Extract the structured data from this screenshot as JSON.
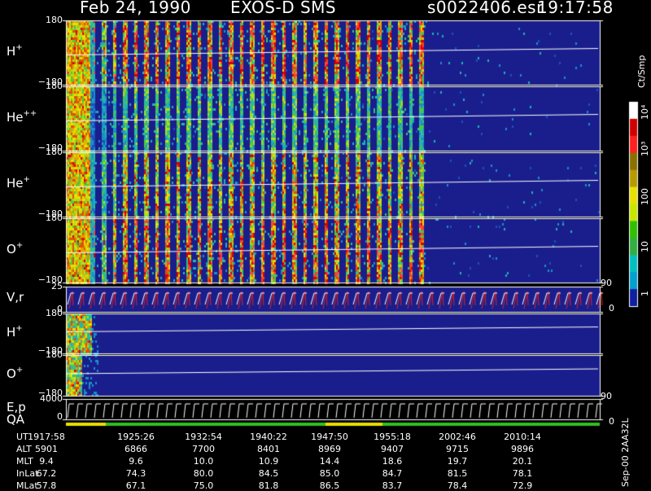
{
  "title": {
    "date": "Feb 24, 1990",
    "instrument": "EXOS-D SMS",
    "file": "s0022406.esr",
    "time": "19:17:58"
  },
  "panels": [
    {
      "label": "H",
      "charge": "+",
      "ymax": "180",
      "ymin": "−180"
    },
    {
      "label": "He",
      "charge": "++",
      "ymax": "180",
      "ymin": "−180"
    },
    {
      "label": "He",
      "charge": "+",
      "ymax": "180",
      "ymin": "−180"
    },
    {
      "label": "O",
      "charge": "+",
      "ymax": "180",
      "ymin": "−180"
    },
    {
      "label": "V,r",
      "charge": "",
      "ymax": "25",
      "ymin": "0"
    },
    {
      "label": "H",
      "charge": "+",
      "ymax": "180",
      "ymin": "−180"
    },
    {
      "label": "O",
      "charge": "+",
      "ymax": "180",
      "ymin": "−180"
    },
    {
      "label": "E,p",
      "charge": "",
      "ymax": "4000",
      "ymin": "0"
    }
  ],
  "qa_label": "QA",
  "right_ticks": {
    "vr_top": "90",
    "vr_bottom": "0",
    "ep_top": "90",
    "ep_bottom": "0"
  },
  "colorbar": {
    "unit": "Ct/Smp",
    "labels": [
      "10⁴",
      "10³",
      "100",
      "10",
      "1"
    ],
    "colors": [
      "#ffffff",
      "#d00000",
      "#ff2020",
      "#8a7000",
      "#b89a00",
      "#e8e000",
      "#c8e800",
      "#30c000",
      "#30b040",
      "#00c0c0",
      "#00a0d0",
      "#1020a0"
    ]
  },
  "footer_note": "Sep-00 2AA32L",
  "chart_data": {
    "type": "heatmap",
    "x": [
      "1917:58",
      "1925:26",
      "1932:54",
      "1940:22",
      "1947:50",
      "1955:18",
      "2002:46",
      "2010:14"
    ],
    "rows": [
      {
        "name": "UT",
        "values": [
          "1917:58",
          "1925:26",
          "1932:54",
          "1940:22",
          "1947:50",
          "1955:18",
          "2002:46",
          "2010:14"
        ]
      },
      {
        "name": "ALT",
        "values": [
          "5901",
          "6866",
          "7700",
          "8401",
          "8969",
          "9407",
          "9715",
          "9896"
        ]
      },
      {
        "name": "MLT",
        "values": [
          "9.4",
          "9.6",
          "10.0",
          "10.9",
          "14.4",
          "18.6",
          "19.7",
          "20.1"
        ]
      },
      {
        "name": "InLat",
        "values": [
          "67.2",
          "74.3",
          "80.0",
          "84.5",
          "85.0",
          "84.7",
          "81.5",
          "78.1"
        ]
      },
      {
        "name": "MLat",
        "values": [
          "57.8",
          "67.1",
          "75.0",
          "81.8",
          "86.5",
          "83.7",
          "78.4",
          "72.9"
        ]
      }
    ],
    "color_scale": "log",
    "color_range": [
      1,
      10000
    ]
  }
}
